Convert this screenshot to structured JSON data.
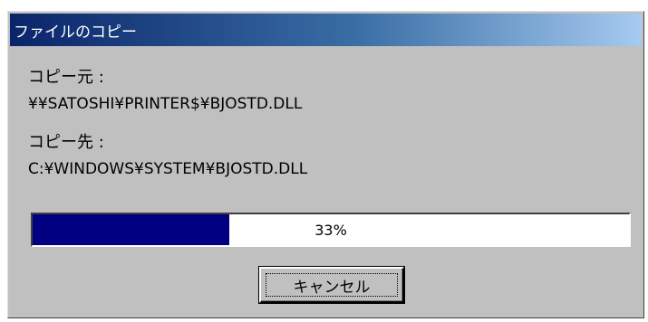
{
  "window": {
    "title": "ファイルのコピー"
  },
  "copy": {
    "source_label": "コピー元 :",
    "source_path": "¥¥SATOSHI¥PRINTER$¥BJOSTD.DLL",
    "dest_label": "コピー先 :",
    "dest_path": "C:¥WINDOWS¥SYSTEM¥BJOSTD.DLL"
  },
  "progress": {
    "percent": 33,
    "text": "33%",
    "fill_color": "#000080"
  },
  "buttons": {
    "cancel_label": "キャンセル"
  }
}
